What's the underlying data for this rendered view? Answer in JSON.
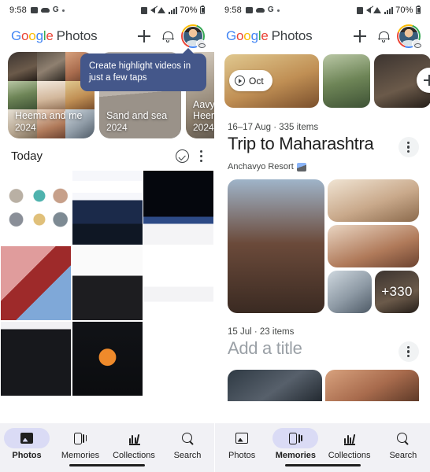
{
  "left_phone": {
    "status_bar": {
      "time": "9:58",
      "battery": "70%",
      "icons": [
        "photos-notification-icon",
        "cloud-icon",
        "google-icon",
        "dot-icon",
        "vibrate-icon",
        "mute-icon",
        "wifi-icon",
        "signal-bars-icon",
        "battery-icon"
      ]
    },
    "app_bar": {
      "brand": {
        "g1": "G",
        "o1": "o",
        "o2": "o",
        "g2": "g",
        "l": "l",
        "e": "e",
        "photos": "Photos"
      },
      "add_label": "+",
      "notifications_label": "Notifications",
      "avatar_label": "Account"
    },
    "tooltip": {
      "text": "Create highlight videos in just a few taps"
    },
    "memories": [
      {
        "title": "Heema and me",
        "year": "2024"
      },
      {
        "title": "Sand and sea",
        "year": "2024"
      },
      {
        "title": "Aavyan & Heema",
        "year": "2024"
      }
    ],
    "today": {
      "title": "Today",
      "select_label": "Select",
      "more_label": "More options"
    },
    "bottom_nav": {
      "items": [
        {
          "label": "Photos",
          "icon": "photos-icon",
          "active": true
        },
        {
          "label": "Memories",
          "icon": "memories-icon",
          "active": false
        },
        {
          "label": "Collections",
          "icon": "collections-icon",
          "active": false
        },
        {
          "label": "Search",
          "icon": "search-icon",
          "active": false
        }
      ]
    }
  },
  "right_phone": {
    "status_bar": {
      "time": "9:58",
      "battery": "70%"
    },
    "app_bar": {
      "brand": {
        "g1": "G",
        "o1": "o",
        "o2": "o",
        "g2": "g",
        "l": "l",
        "e": "e",
        "photos": "Photos"
      }
    },
    "carousel": {
      "month_chip": "Oct",
      "add_label": "+",
      "scroll_label": "Scroll"
    },
    "memory_blocks": [
      {
        "meta": "16–17 Aug  ·  335 items",
        "title": "Trip to Maharashtra",
        "subtitle": "Anchavyo Resort",
        "subtitle_icon": "location-photo-icon",
        "more_label": "More options",
        "overflow_count": "+330"
      },
      {
        "meta": "15 Jul  ·  23 items",
        "title": "Add a title",
        "title_is_placeholder": true,
        "more_label": "More options"
      }
    ],
    "bottom_nav": {
      "items": [
        {
          "label": "Photos",
          "icon": "photos-icon",
          "active": false
        },
        {
          "label": "Memories",
          "icon": "memories-icon",
          "active": true
        },
        {
          "label": "Collections",
          "icon": "collections-icon",
          "active": false
        },
        {
          "label": "Search",
          "icon": "search-icon",
          "active": false
        }
      ]
    }
  },
  "colors": {
    "tooltip_bg": "#44578a",
    "nav_bg": "#f1f1f5",
    "nav_pill_active": "#dadbf5",
    "google_blue": "#4285f4",
    "google_red": "#ea4335",
    "google_yellow": "#fbbc04",
    "google_green": "#34a853"
  }
}
